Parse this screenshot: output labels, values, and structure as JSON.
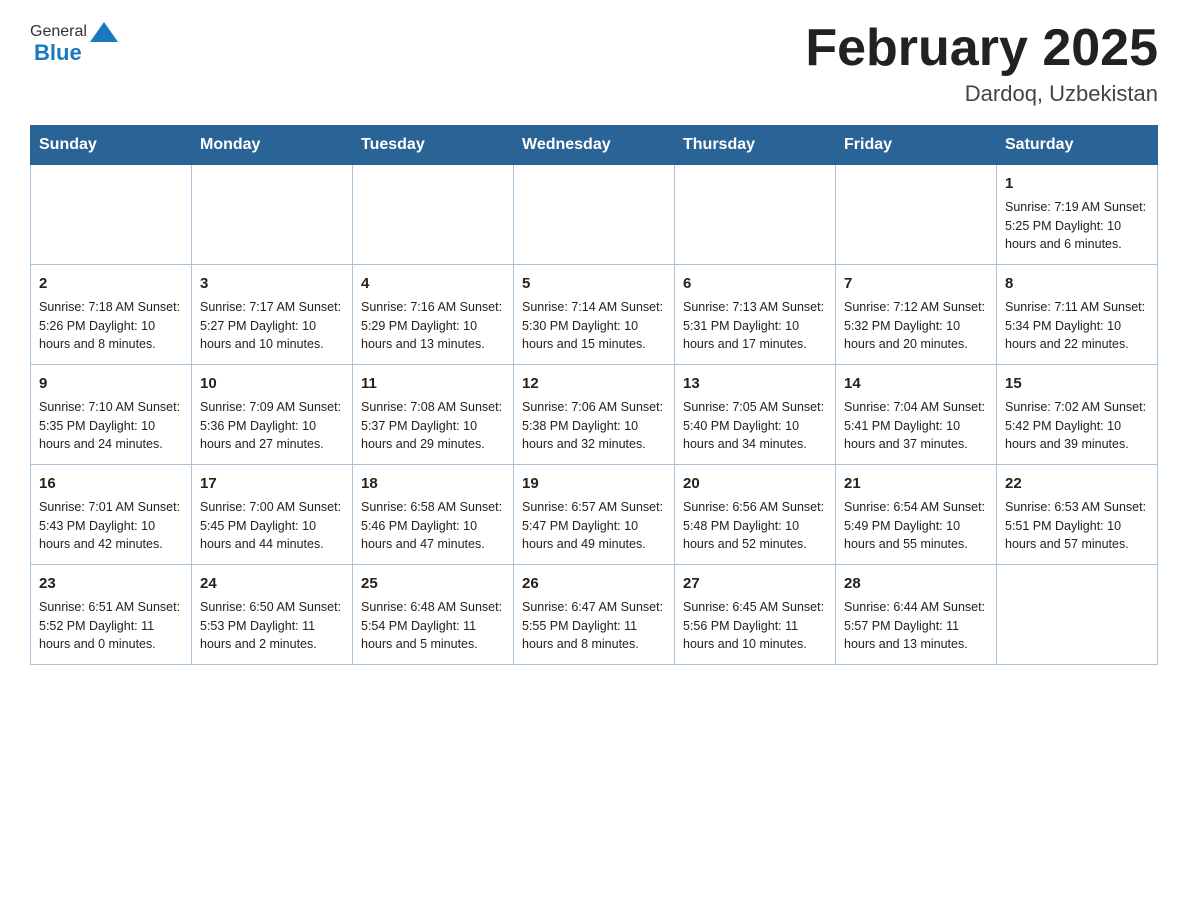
{
  "header": {
    "logo_general": "General",
    "logo_blue": "Blue",
    "title": "February 2025",
    "location": "Dardoq, Uzbekistan"
  },
  "weekdays": [
    "Sunday",
    "Monday",
    "Tuesday",
    "Wednesday",
    "Thursday",
    "Friday",
    "Saturday"
  ],
  "weeks": [
    [
      {
        "day": "",
        "info": ""
      },
      {
        "day": "",
        "info": ""
      },
      {
        "day": "",
        "info": ""
      },
      {
        "day": "",
        "info": ""
      },
      {
        "day": "",
        "info": ""
      },
      {
        "day": "",
        "info": ""
      },
      {
        "day": "1",
        "info": "Sunrise: 7:19 AM\nSunset: 5:25 PM\nDaylight: 10 hours and 6 minutes."
      }
    ],
    [
      {
        "day": "2",
        "info": "Sunrise: 7:18 AM\nSunset: 5:26 PM\nDaylight: 10 hours and 8 minutes."
      },
      {
        "day": "3",
        "info": "Sunrise: 7:17 AM\nSunset: 5:27 PM\nDaylight: 10 hours and 10 minutes."
      },
      {
        "day": "4",
        "info": "Sunrise: 7:16 AM\nSunset: 5:29 PM\nDaylight: 10 hours and 13 minutes."
      },
      {
        "day": "5",
        "info": "Sunrise: 7:14 AM\nSunset: 5:30 PM\nDaylight: 10 hours and 15 minutes."
      },
      {
        "day": "6",
        "info": "Sunrise: 7:13 AM\nSunset: 5:31 PM\nDaylight: 10 hours and 17 minutes."
      },
      {
        "day": "7",
        "info": "Sunrise: 7:12 AM\nSunset: 5:32 PM\nDaylight: 10 hours and 20 minutes."
      },
      {
        "day": "8",
        "info": "Sunrise: 7:11 AM\nSunset: 5:34 PM\nDaylight: 10 hours and 22 minutes."
      }
    ],
    [
      {
        "day": "9",
        "info": "Sunrise: 7:10 AM\nSunset: 5:35 PM\nDaylight: 10 hours and 24 minutes."
      },
      {
        "day": "10",
        "info": "Sunrise: 7:09 AM\nSunset: 5:36 PM\nDaylight: 10 hours and 27 minutes."
      },
      {
        "day": "11",
        "info": "Sunrise: 7:08 AM\nSunset: 5:37 PM\nDaylight: 10 hours and 29 minutes."
      },
      {
        "day": "12",
        "info": "Sunrise: 7:06 AM\nSunset: 5:38 PM\nDaylight: 10 hours and 32 minutes."
      },
      {
        "day": "13",
        "info": "Sunrise: 7:05 AM\nSunset: 5:40 PM\nDaylight: 10 hours and 34 minutes."
      },
      {
        "day": "14",
        "info": "Sunrise: 7:04 AM\nSunset: 5:41 PM\nDaylight: 10 hours and 37 minutes."
      },
      {
        "day": "15",
        "info": "Sunrise: 7:02 AM\nSunset: 5:42 PM\nDaylight: 10 hours and 39 minutes."
      }
    ],
    [
      {
        "day": "16",
        "info": "Sunrise: 7:01 AM\nSunset: 5:43 PM\nDaylight: 10 hours and 42 minutes."
      },
      {
        "day": "17",
        "info": "Sunrise: 7:00 AM\nSunset: 5:45 PM\nDaylight: 10 hours and 44 minutes."
      },
      {
        "day": "18",
        "info": "Sunrise: 6:58 AM\nSunset: 5:46 PM\nDaylight: 10 hours and 47 minutes."
      },
      {
        "day": "19",
        "info": "Sunrise: 6:57 AM\nSunset: 5:47 PM\nDaylight: 10 hours and 49 minutes."
      },
      {
        "day": "20",
        "info": "Sunrise: 6:56 AM\nSunset: 5:48 PM\nDaylight: 10 hours and 52 minutes."
      },
      {
        "day": "21",
        "info": "Sunrise: 6:54 AM\nSunset: 5:49 PM\nDaylight: 10 hours and 55 minutes."
      },
      {
        "day": "22",
        "info": "Sunrise: 6:53 AM\nSunset: 5:51 PM\nDaylight: 10 hours and 57 minutes."
      }
    ],
    [
      {
        "day": "23",
        "info": "Sunrise: 6:51 AM\nSunset: 5:52 PM\nDaylight: 11 hours and 0 minutes."
      },
      {
        "day": "24",
        "info": "Sunrise: 6:50 AM\nSunset: 5:53 PM\nDaylight: 11 hours and 2 minutes."
      },
      {
        "day": "25",
        "info": "Sunrise: 6:48 AM\nSunset: 5:54 PM\nDaylight: 11 hours and 5 minutes."
      },
      {
        "day": "26",
        "info": "Sunrise: 6:47 AM\nSunset: 5:55 PM\nDaylight: 11 hours and 8 minutes."
      },
      {
        "day": "27",
        "info": "Sunrise: 6:45 AM\nSunset: 5:56 PM\nDaylight: 11 hours and 10 minutes."
      },
      {
        "day": "28",
        "info": "Sunrise: 6:44 AM\nSunset: 5:57 PM\nDaylight: 11 hours and 13 minutes."
      },
      {
        "day": "",
        "info": ""
      }
    ]
  ]
}
